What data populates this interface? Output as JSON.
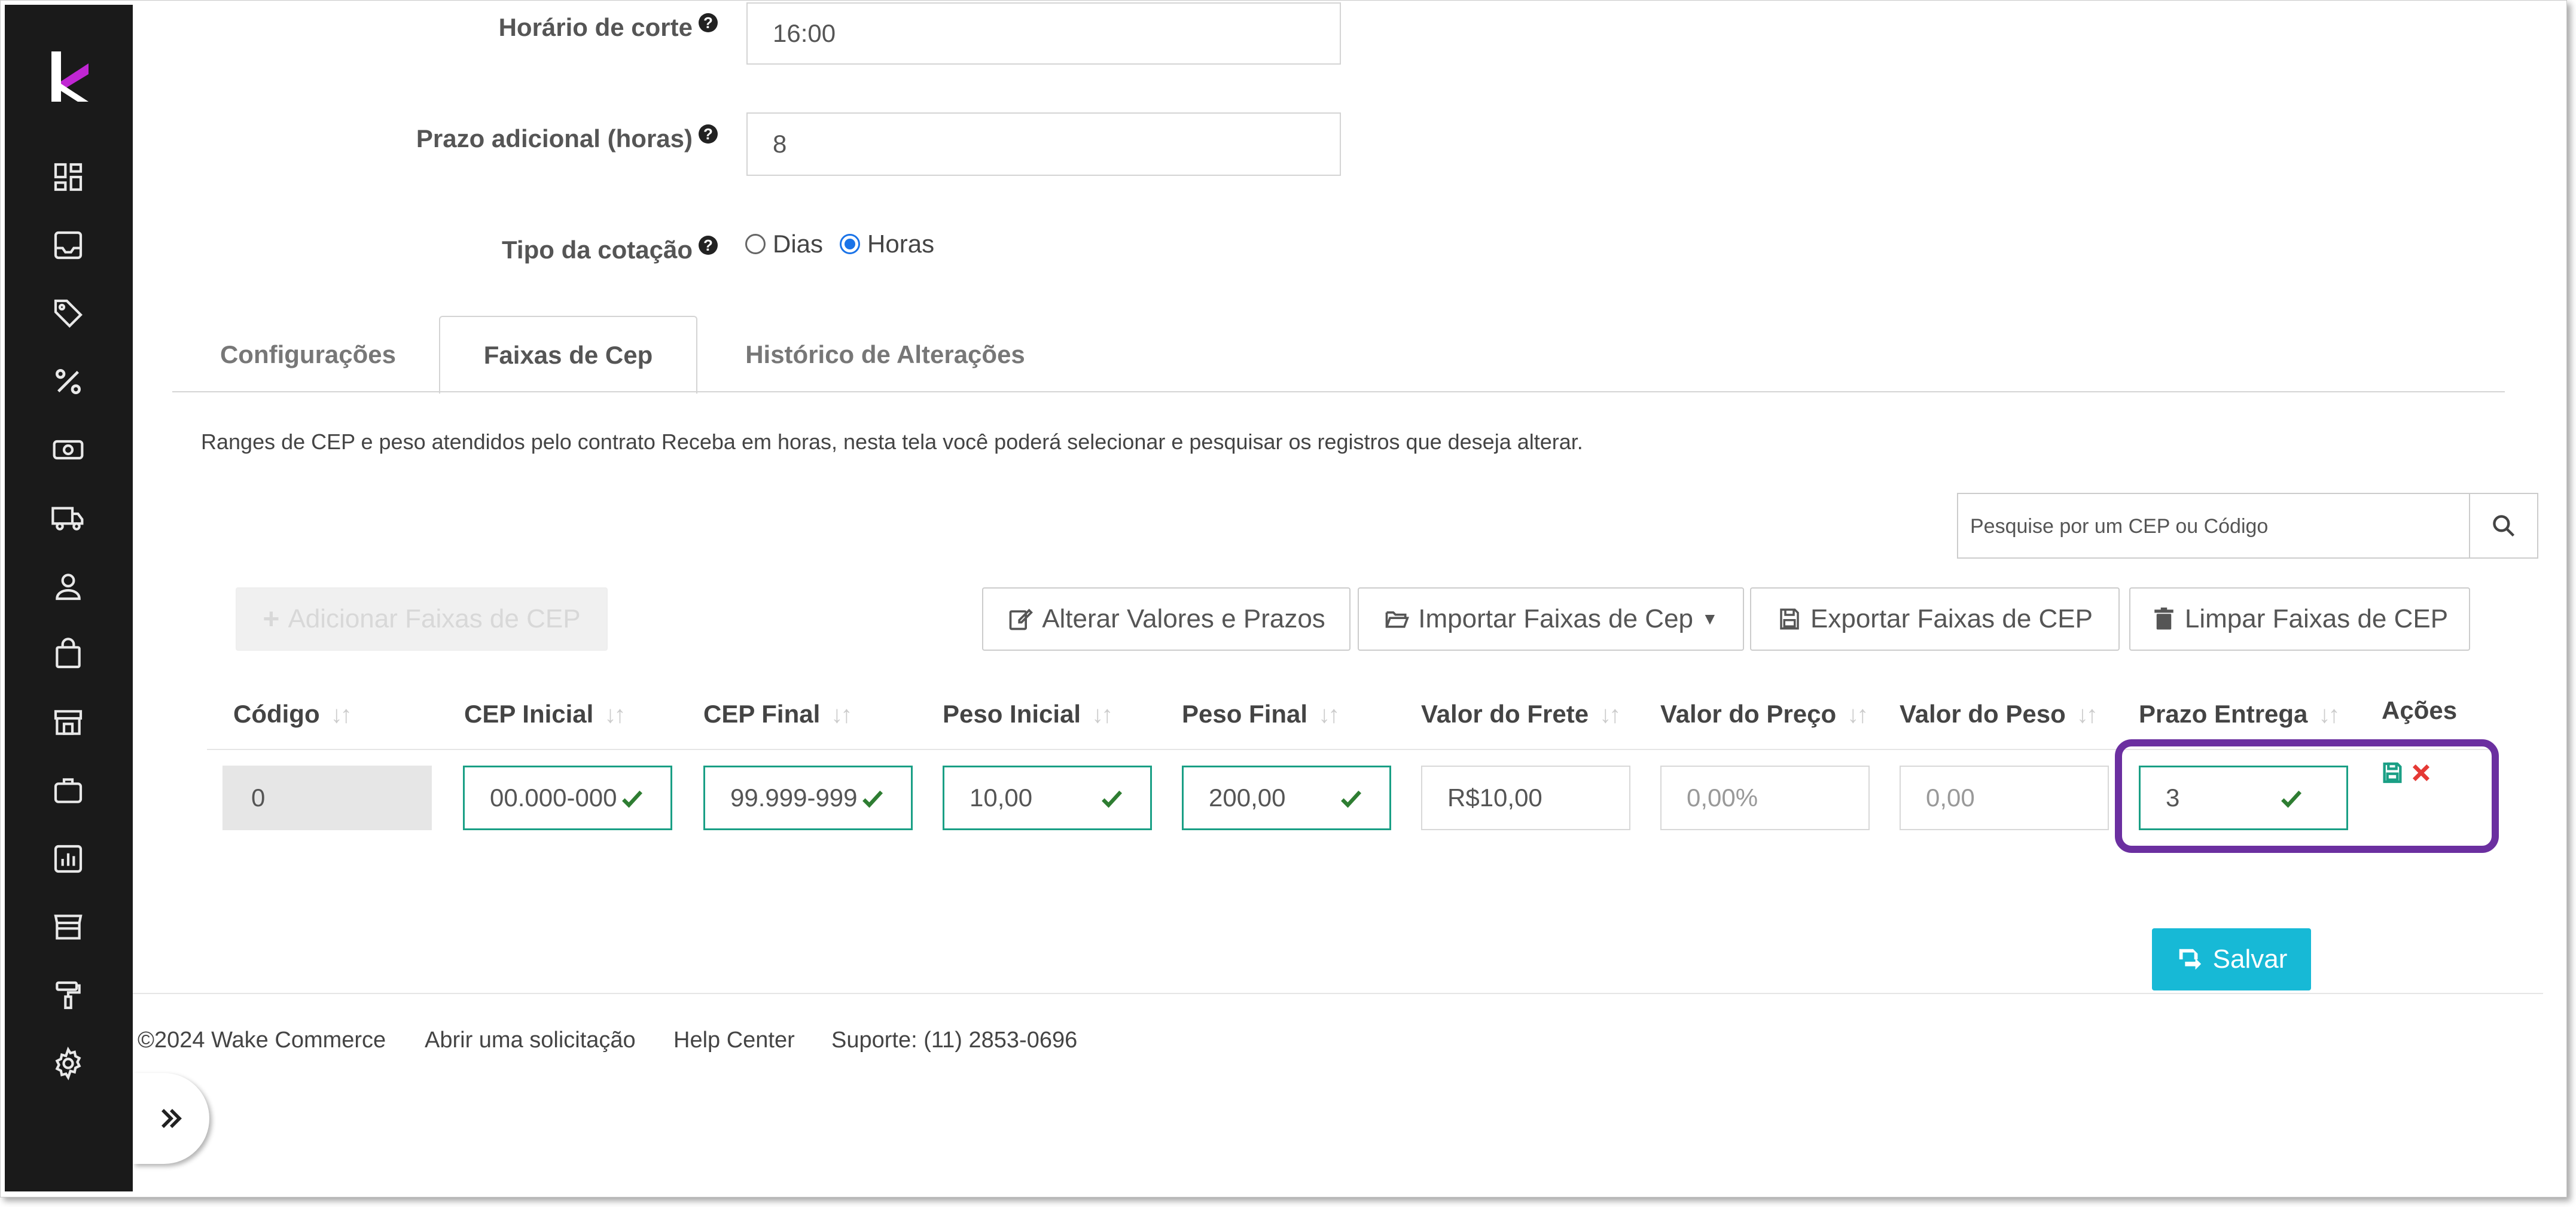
{
  "form": {
    "cutoff_label": "Horário de corte",
    "cutoff_value": "16:00",
    "extra_label": "Prazo adicional (horas)",
    "extra_value": "8",
    "quote_label": "Tipo da cotação",
    "quote_options": [
      "Dias",
      "Horas"
    ],
    "quote_selected": "Horas",
    "help_glyph": "?"
  },
  "tabs": [
    {
      "label": "Configurações",
      "active": false
    },
    {
      "label": "Faixas de Cep",
      "active": true
    },
    {
      "label": "Histórico de Alterações",
      "active": false
    }
  ],
  "description": "Ranges de CEP e peso atendidos pelo contrato Receba em horas, nesta tela você poderá selecionar e pesquisar os registros que deseja alterar.",
  "search": {
    "placeholder": "Pesquise por um CEP ou Código"
  },
  "toolbar": {
    "add_label": "Adicionar Faixas de CEP",
    "alter_label": "Alterar Valores e Prazos",
    "import_label": "Importar Faixas de Cep",
    "export_label": "Exportar Faixas de CEP",
    "clear_label": "Limpar Faixas de CEP"
  },
  "table": {
    "headers": [
      "Código",
      "CEP Inicial",
      "CEP Final",
      "Peso Inicial",
      "Peso Final",
      "Valor do Frete",
      "Valor do Preço",
      "Valor do Peso",
      "Prazo Entrega",
      "Ações"
    ],
    "row": {
      "codigo": "0",
      "cep_inicial": "00.000-000",
      "cep_final": "99.999-999",
      "peso_inicial": "10,00",
      "peso_final": "200,00",
      "valor_frete": "R$10,00",
      "valor_preco": "0,00%",
      "valor_peso": "0,00",
      "prazo_entrega": "3"
    }
  },
  "save_label": "Salvar",
  "footer": {
    "copyright": "©2024 Wake Commerce",
    "request": "Abrir uma solicitação",
    "help": "Help Center",
    "support": "Suporte: (11) 2853-0696"
  },
  "colors": {
    "sidebar": "#1a1a1a",
    "logo_accent": "#c026d3",
    "valid_border": "#1a9f85",
    "check": "#2e7d32",
    "highlight": "#6b2fa0",
    "save_button": "#17b9d6",
    "delete_icon": "#e53935"
  },
  "icons": [
    "dashboard-icon",
    "inbox-icon",
    "tag-icon",
    "percent-icon",
    "money-icon",
    "truck-icon",
    "user-icon",
    "shopping-bag-icon",
    "store-icon",
    "briefcase-icon",
    "report-icon",
    "storefront-icon",
    "paint-roller-icon",
    "gear-icon"
  ]
}
